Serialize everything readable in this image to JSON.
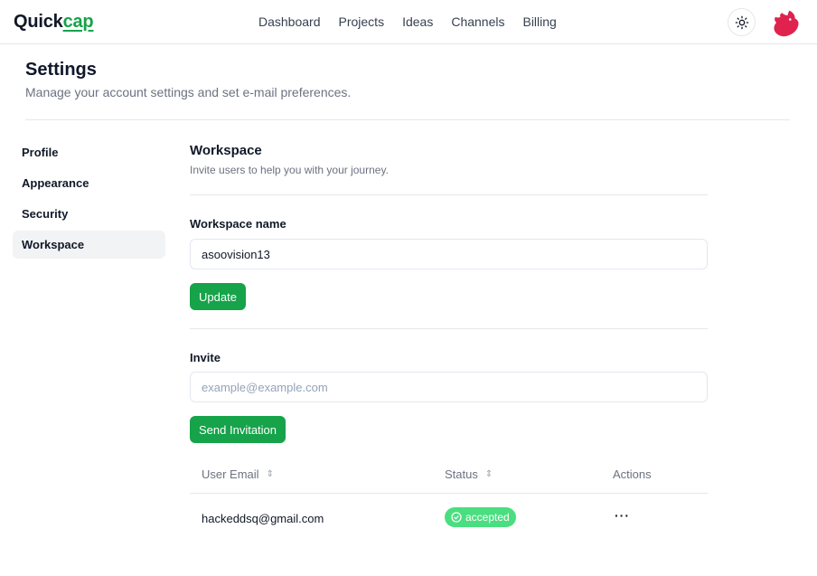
{
  "header": {
    "logo_main": "Quick",
    "logo_accent": "cap",
    "nav": [
      "Dashboard",
      "Projects",
      "Ideas",
      "Channels",
      "Billing"
    ]
  },
  "page": {
    "title": "Settings",
    "subtitle": "Manage your account settings and set e-mail preferences."
  },
  "sidebar": {
    "items": [
      "Profile",
      "Appearance",
      "Security",
      "Workspace"
    ],
    "active_index": 3
  },
  "workspace": {
    "title": "Workspace",
    "description": "Invite users to help you with your journey.",
    "name_label": "Workspace name",
    "name_value": "asoovision13",
    "update_label": "Update",
    "invite_label": "Invite",
    "invite_placeholder": "example@example.com",
    "invite_button": "Send Invitation"
  },
  "table": {
    "columns": {
      "email": "User Email",
      "status": "Status",
      "actions": "Actions"
    },
    "rows": [
      {
        "email": "hackeddsq@gmail.com",
        "status": "accepted"
      }
    ]
  },
  "colors": {
    "accent": "#16a34a",
    "badge": "#4ade80",
    "avatar": "#e0234e"
  },
  "icons": {
    "theme": "sun-icon",
    "avatar": "nest-cat-logo",
    "sort": "sort-icon",
    "status": "check-circle-icon",
    "actions": "more-horizontal-icon"
  }
}
